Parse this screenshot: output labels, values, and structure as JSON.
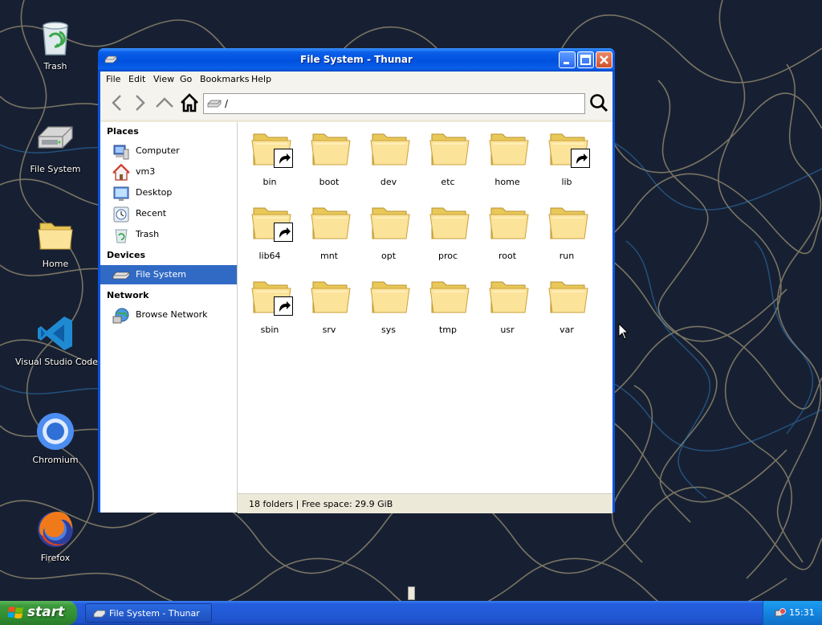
{
  "desktop": {
    "icons": [
      {
        "label": "Trash"
      },
      {
        "label": "File System"
      },
      {
        "label": "Home"
      },
      {
        "label": "Visual Studio Code"
      },
      {
        "label": "Chromium"
      },
      {
        "label": "Firefox"
      }
    ]
  },
  "window": {
    "title": "File System - Thunar",
    "menu": [
      "File",
      "Edit",
      "View",
      "Go",
      "Bookmarks",
      "Help"
    ],
    "path": "/",
    "sidebar": {
      "places_header": "Places",
      "places": [
        "Computer",
        "vm3",
        "Desktop",
        "Recent",
        "Trash"
      ],
      "devices_header": "Devices",
      "devices": [
        "File System"
      ],
      "network_header": "Network",
      "network": [
        "Browse Network"
      ],
      "selected": "File System"
    },
    "folders": [
      {
        "name": "bin",
        "symlink": true
      },
      {
        "name": "boot",
        "symlink": false
      },
      {
        "name": "dev",
        "symlink": false
      },
      {
        "name": "etc",
        "symlink": false
      },
      {
        "name": "home",
        "symlink": false
      },
      {
        "name": "lib",
        "symlink": true
      },
      {
        "name": "lib64",
        "symlink": true
      },
      {
        "name": "mnt",
        "symlink": false
      },
      {
        "name": "opt",
        "symlink": false
      },
      {
        "name": "proc",
        "symlink": false
      },
      {
        "name": "root",
        "symlink": false
      },
      {
        "name": "run",
        "symlink": false
      },
      {
        "name": "sbin",
        "symlink": true
      },
      {
        "name": "srv",
        "symlink": false
      },
      {
        "name": "sys",
        "symlink": false
      },
      {
        "name": "tmp",
        "symlink": false
      },
      {
        "name": "usr",
        "symlink": false
      },
      {
        "name": "var",
        "symlink": false
      }
    ],
    "status": "18 folders  |  Free space: 29.9 GiB"
  },
  "taskbar": {
    "start_label": "start",
    "task_label": "File System - Thunar",
    "clock": "15:31"
  },
  "colors": {
    "titlebar": "#0054e3",
    "selection": "#316ac5",
    "taskbar": "#245edc",
    "start": "#3c9a3c",
    "wallpaper": "#172033"
  }
}
